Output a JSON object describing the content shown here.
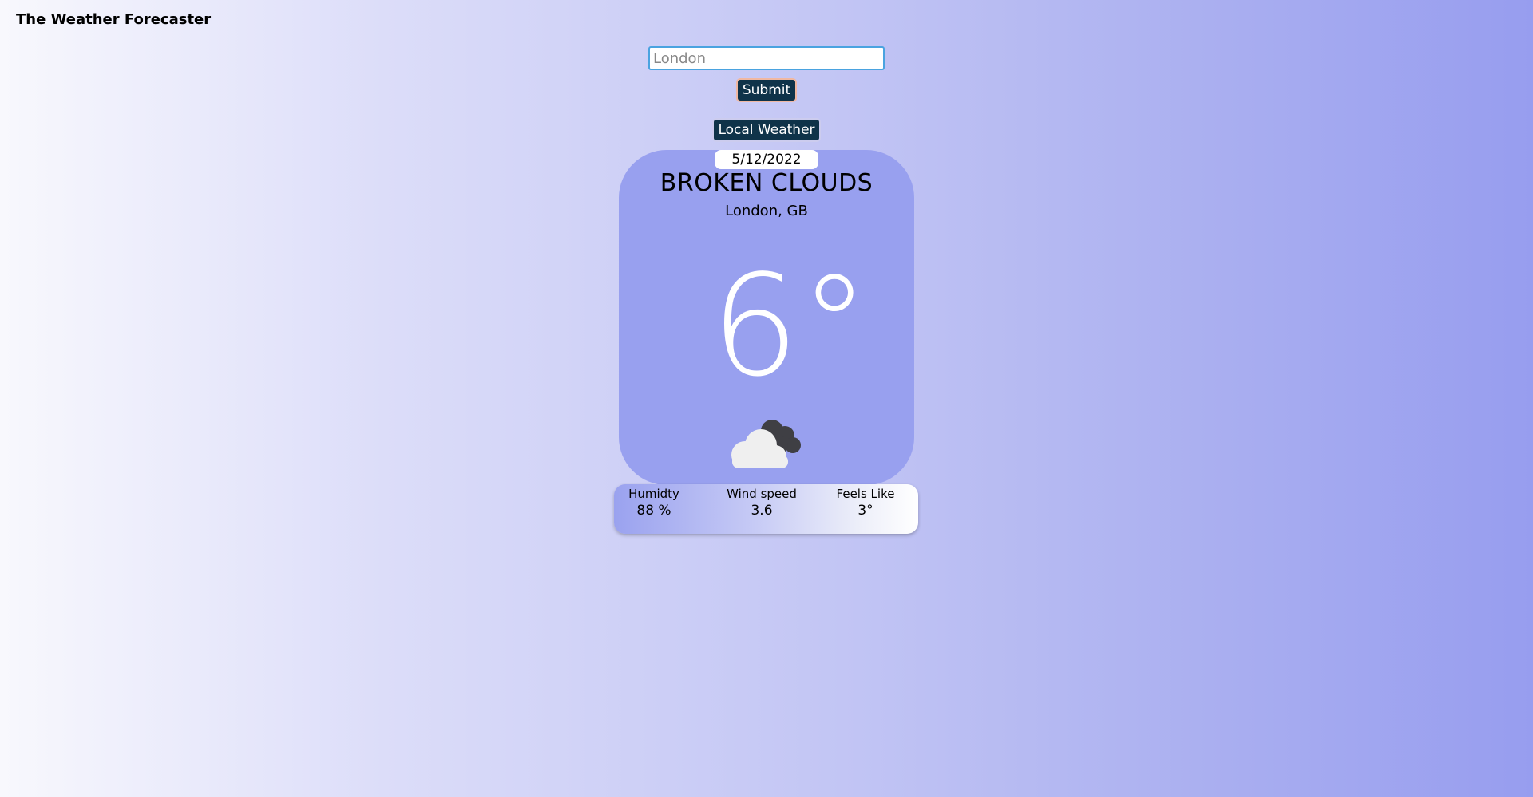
{
  "app": {
    "title": "The Weather Forecaster"
  },
  "search": {
    "placeholder": "London",
    "value": ""
  },
  "buttons": {
    "submit_label": "Submit",
    "local_weather_label": "Local Weather"
  },
  "weather": {
    "date": "5/12/2022",
    "condition": "BROKEN CLOUDS",
    "location": "London, GB",
    "temperature": "6°",
    "icon": "broken-clouds-icon"
  },
  "stats": {
    "humidity_label": "Humidty",
    "humidity_value": "88 %",
    "wind_label": "Wind speed",
    "wind_value": "3.6",
    "feels_label": "Feels Like",
    "feels_value": "3°"
  },
  "colors": {
    "button_bg": "#0f3349",
    "card_bg": "#98a0ef",
    "temperature_text": "#ffffff",
    "gradient_end": "#979def"
  }
}
